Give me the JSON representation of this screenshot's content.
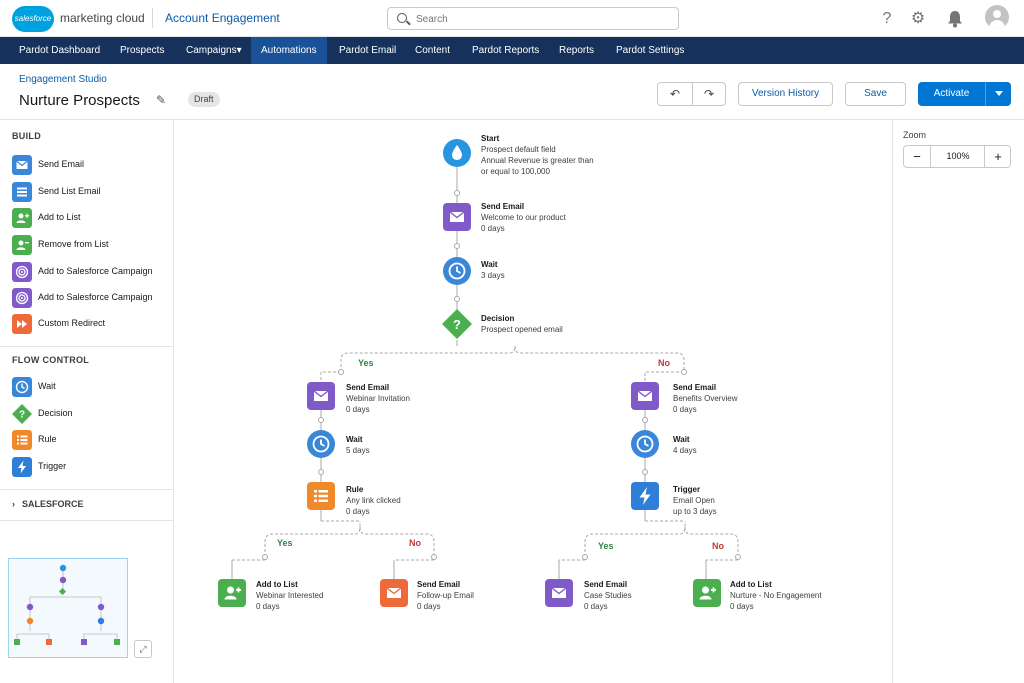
{
  "header": {
    "logo_text": "salesforce",
    "brand": "marketing cloud",
    "app": "Account Engagement",
    "search_placeholder": "Search"
  },
  "nav": {
    "items": [
      {
        "label": "Pardot Dashboard"
      },
      {
        "label": "Prospects"
      },
      {
        "label": "Campaigns▾"
      },
      {
        "label": "Automations",
        "active": true
      },
      {
        "label": "Pardot Email"
      },
      {
        "label": "Content"
      },
      {
        "label": "Pardot Reports"
      },
      {
        "label": "Reports"
      },
      {
        "label": "Pardot Settings"
      }
    ]
  },
  "page": {
    "breadcrumb": "Engagement Studio",
    "title": "Nurture Prospects",
    "badge": "Draft",
    "buttons": {
      "version_history": "Version History",
      "save": "Save",
      "activate": "Activate"
    }
  },
  "left_panel": {
    "build_title": "BUILD",
    "build_items": [
      {
        "label": "Send Email",
        "icon": "email-icon"
      },
      {
        "label": "Send List Email",
        "icon": "list-email-icon"
      },
      {
        "label": "Add to List",
        "icon": "add-user-icon"
      },
      {
        "label": "Remove from List",
        "icon": "remove-user-icon"
      },
      {
        "label": "Add to Salesforce Campaign",
        "icon": "campaign-icon"
      },
      {
        "label": "Add to Salesforce Campaign",
        "icon": "campaign-icon"
      },
      {
        "label": "Custom Redirect",
        "icon": "redirect-icon"
      }
    ],
    "flow_title": "FLOW CONTROL",
    "flow_items": [
      {
        "label": "Wait",
        "icon": "clock-icon"
      },
      {
        "label": "Decision",
        "icon": "decision-icon"
      },
      {
        "label": "Rule",
        "icon": "rule-icon"
      },
      {
        "label": "Trigger",
        "icon": "trigger-icon"
      }
    ],
    "salesforce_title": "SALESFORCE"
  },
  "flow": {
    "start": {
      "title": "Start",
      "line1": "Prospect default field",
      "line2": "Annual Revenue is greater than",
      "line3": "or equal to 100,000"
    },
    "send_welcome": {
      "title": "Send Email",
      "line1": "Welcome to our product",
      "line2": "0 days"
    },
    "wait_main": {
      "title": "Wait",
      "line1": "3 days"
    },
    "decision": {
      "title": "Decision",
      "line1": "Prospect opened email"
    },
    "yes_label": "Yes",
    "no_label": "No",
    "left": {
      "send": {
        "title": "Send Email",
        "line1": "Webinar Invitation",
        "line2": "0 days"
      },
      "wait": {
        "title": "Wait",
        "line1": "5 days"
      },
      "rule": {
        "title": "Rule",
        "line1": "Any link clicked",
        "line2": "0 days"
      },
      "yes_action": {
        "title": "Add to List",
        "line1": "Webinar Interested",
        "line2": "0 days"
      },
      "no_action": {
        "title": "Send Email",
        "line1": "Follow-up Email",
        "line2": "0 days"
      }
    },
    "right": {
      "send": {
        "title": "Send Email",
        "line1": "Benefits Overview",
        "line2": "0 days"
      },
      "wait": {
        "title": "Wait",
        "line1": "4 days"
      },
      "trigger": {
        "title": "Trigger",
        "line1": "Email Open",
        "line2": "up to 3 days"
      },
      "yes_action": {
        "title": "Send Email",
        "line1": "Case Studies",
        "line2": "0 days"
      },
      "no_action": {
        "title": "Add to List",
        "line1": "Nurture - No Engagement",
        "line2": "0 days"
      }
    }
  },
  "zoom": {
    "label": "Zoom",
    "value": "100%",
    "minus": "−",
    "plus": "+"
  },
  "colors": {
    "email": "#7f5ac8",
    "wait": "#3a87d9",
    "decision": "#4bae4f",
    "rule": "#f0892a",
    "trigger": "#2f7ed8",
    "list": "#4bae4f",
    "start": "#2795e0",
    "redirect": "#ef6a3b",
    "nav_bg": "#16325c",
    "nav_active": "#1b5297",
    "primary": "#0176d3"
  }
}
